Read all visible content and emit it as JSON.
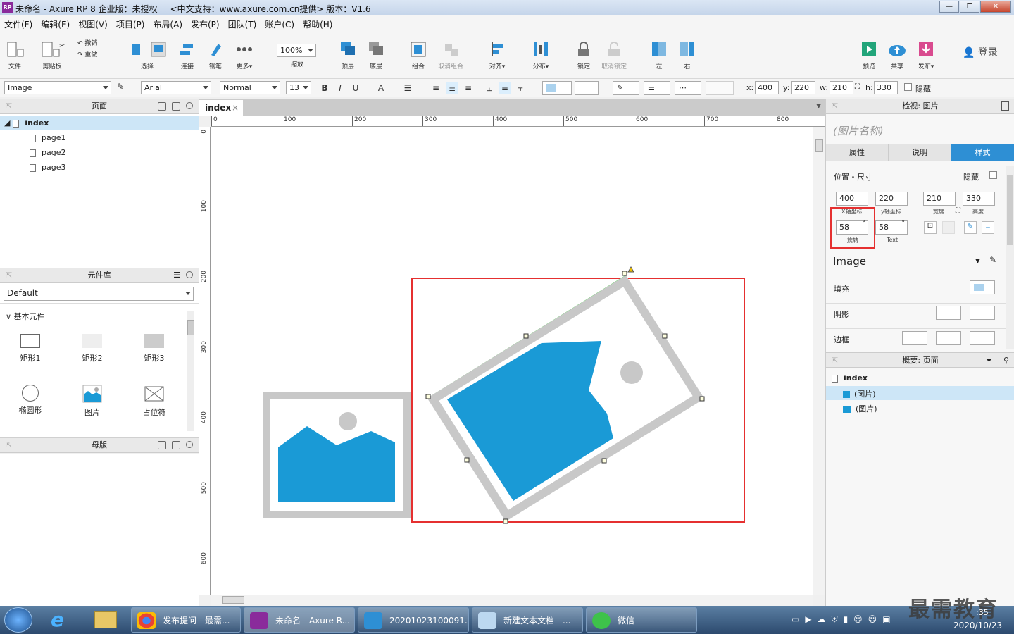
{
  "titlebar": {
    "title": "未命名 - Axure RP 8 企业版：未授权",
    "support": "<中文支持：www.axure.com.cn提供> 版本：V1.6",
    "logo": "RP"
  },
  "menu": [
    "文件(F)",
    "编辑(E)",
    "视图(V)",
    "项目(P)",
    "布局(A)",
    "发布(P)",
    "团队(T)",
    "账户(C)",
    "帮助(H)"
  ],
  "toolbar": {
    "file": "文件",
    "clipboard": "剪贴板",
    "undo": "撤销",
    "redo": "重做",
    "select": "选择",
    "connect": "连接",
    "pen": "钢笔",
    "more": "更多▾",
    "zoom_value": "100%",
    "zoom": "缩放",
    "top": "顶层",
    "bottom": "底层",
    "group": "组合",
    "ungroup": "取消组合",
    "align": "对齐▾",
    "distribute": "分布▾",
    "lock": "锁定",
    "unlock": "取消锁定",
    "left": "左",
    "right": "右",
    "preview": "预览",
    "share": "共享",
    "publish": "发布▾",
    "login": "登录"
  },
  "format": {
    "style": "Image",
    "font": "Arial",
    "weight": "Normal",
    "size": "13",
    "x_label": "x:",
    "x": "400",
    "y_label": "y:",
    "y": "220",
    "w_label": "w:",
    "w": "210",
    "h_label": "h:",
    "h": "330",
    "hidden": "隐藏",
    "bold": "B",
    "italic": "I",
    "underline": "U",
    "font_color": "A"
  },
  "pages": {
    "title": "页面",
    "items": [
      "index",
      "page1",
      "page2",
      "page3"
    ]
  },
  "library": {
    "title": "元件库",
    "selected": "Default",
    "group": "基本元件",
    "widgets": [
      "矩形1",
      "矩形2",
      "矩形3",
      "椭圆形",
      "图片",
      "占位符"
    ]
  },
  "masters": {
    "title": "母版"
  },
  "canvas": {
    "tab": "index",
    "ruler_top": [
      "0",
      "100",
      "200",
      "300",
      "400",
      "500",
      "600",
      "700",
      "800"
    ],
    "ruler_left": [
      "0",
      "100",
      "200",
      "300",
      "400",
      "500",
      "600"
    ]
  },
  "inspector": {
    "title": "检视: 图片",
    "name_placeholder": "(图片名称)",
    "tabs": [
      "属性",
      "说明",
      "样式"
    ],
    "section": "位置・尺寸",
    "hidden": "隐藏",
    "x": "400",
    "y": "220",
    "w": "210",
    "h": "330",
    "x_label": "X轴坐标",
    "y_label": "y轴坐标",
    "w_label": "宽度",
    "h_label": "高度",
    "rotation": "58",
    "rotation_label": "旋转",
    "text_rotation": "58",
    "text_label": "Text",
    "style_name": "Image",
    "fill": "填充",
    "shadow": "阴影",
    "border": "边框"
  },
  "outline": {
    "title": "概要: 页面",
    "root": "index",
    "items": [
      "(图片)",
      "(图片)"
    ]
  },
  "taskbar": {
    "tasks": [
      "发布提问 - 最需...",
      "未命名 - Axure R...",
      "20201023100091...",
      "新建文本文档 - ...",
      "微信"
    ],
    "time": ":35",
    "date": "2020/10/23",
    "watermark": "最需教育"
  },
  "colors": {
    "accent": "#2e8fd4",
    "image_blue": "#1a9ad6",
    "highlight": "#e53030"
  }
}
